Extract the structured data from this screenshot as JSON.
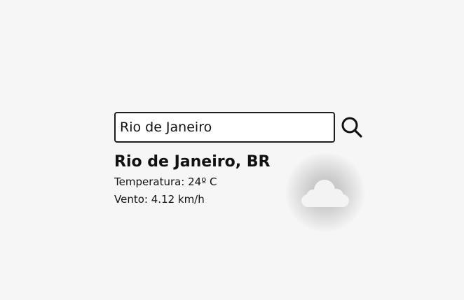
{
  "search": {
    "value": "Rio de Janeiro",
    "button_icon": "search-icon"
  },
  "weather": {
    "location": "Rio de Janeiro, BR",
    "temperature_text": "Temperatura: 24º C",
    "wind_text": "Vento: 4.12 km/h",
    "icon": "cloud-icon"
  }
}
